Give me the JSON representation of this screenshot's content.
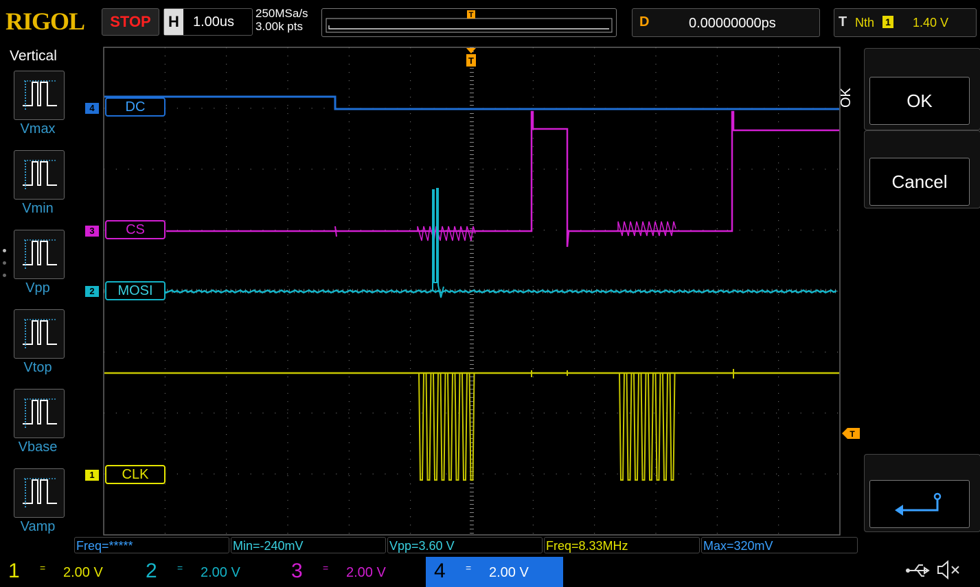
{
  "header": {
    "brand": "RIGOL",
    "run_state": "STOP",
    "horizontal_key": "H",
    "timebase": "1.00us",
    "sample_rate": "250MSa/s",
    "memory_depth": "3.00k pts",
    "trigger_marker": "T",
    "delay_key": "D",
    "delay_value": "0.00000000ps",
    "trigger_key": "T",
    "trigger_mode": "Nth",
    "trigger_channel": "1",
    "trigger_level": "1.40 V"
  },
  "left_menu": {
    "title": "Vertical",
    "items": [
      "Vmax",
      "Vmin",
      "Vpp",
      "Vtop",
      "Vbase",
      "Vamp"
    ]
  },
  "right_menu": {
    "group_label": "OK",
    "ok_label": "OK",
    "cancel_label": "Cancel"
  },
  "channels_on_screen": [
    {
      "num": "4",
      "name": "DC",
      "color": "#1f6fd6"
    },
    {
      "num": "3",
      "name": "CS",
      "color": "#d21ed2"
    },
    {
      "num": "2",
      "name": "MOSI",
      "color": "#14b4c8"
    },
    {
      "num": "1",
      "name": "CLK",
      "color": "#e6e600"
    }
  ],
  "trigger_level_marker": "T",
  "measurements": [
    {
      "text": "Freq=*****",
      "color": "#3aa0ff"
    },
    {
      "text": "Min=-240mV",
      "color": "#3ad0e0"
    },
    {
      "text": "Vpp=3.60 V",
      "color": "#3ad0e0"
    },
    {
      "text": "Freq=8.33MHz",
      "color": "#e6e600"
    },
    {
      "text": "Max=320mV",
      "color": "#3aa0ff"
    }
  ],
  "channel_bar": [
    {
      "num": "1",
      "scale": "2.00 V",
      "color": "#e6e600"
    },
    {
      "num": "2",
      "scale": "2.00 V",
      "color": "#14b4c8"
    },
    {
      "num": "3",
      "scale": "2.00 V",
      "color": "#d21ed2"
    },
    {
      "num": "4",
      "scale": "2.00 V",
      "color": "#3aa0ff"
    }
  ]
}
